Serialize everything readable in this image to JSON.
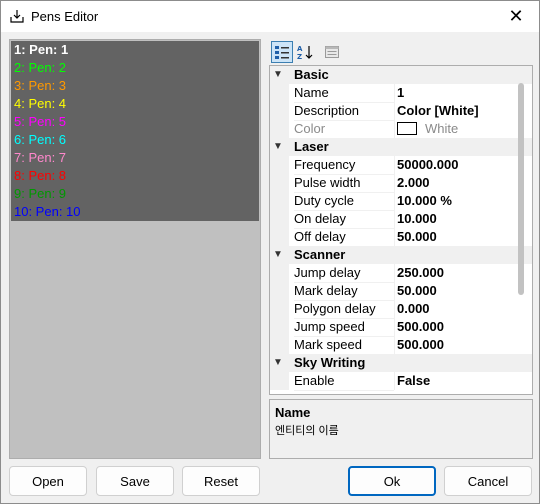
{
  "window": {
    "title": "Pens Editor",
    "close_glyph": "✕"
  },
  "pens": [
    {
      "label": "1: Pen: 1",
      "color": "#ffffff",
      "selected": true
    },
    {
      "label": "2: Pen: 2",
      "color": "#00ff00"
    },
    {
      "label": "3: Pen: 3",
      "color": "#ff9900"
    },
    {
      "label": "4: Pen: 4",
      "color": "#ffff00"
    },
    {
      "label": "5: Pen: 5",
      "color": "#ff00ff"
    },
    {
      "label": "6: Pen: 6",
      "color": "#00ffff"
    },
    {
      "label": "7: Pen: 7",
      "color": "#ff88cc"
    },
    {
      "label": "8: Pen: 8",
      "color": "#ff0000"
    },
    {
      "label": "9: Pen: 9",
      "color": "#009900"
    },
    {
      "label": "10: Pen: 10",
      "color": "#0000ff"
    }
  ],
  "toolbar": {
    "categorized_icon": "categorized-view-icon",
    "alphabetical_icon": "alphabetical-sort-icon",
    "property_pages_icon": "property-pages-icon"
  },
  "categories": {
    "basic": {
      "label": "Basic",
      "name": {
        "label": "Name",
        "value": "1"
      },
      "description": {
        "label": "Description",
        "value": "Color [White]"
      },
      "color": {
        "label": "Color",
        "value": "White"
      }
    },
    "laser": {
      "label": "Laser",
      "frequency": {
        "label": "Frequency",
        "value": "50000.000"
      },
      "pulse_width": {
        "label": "Pulse width",
        "value": "2.000"
      },
      "duty_cycle": {
        "label": "Duty cycle",
        "value": "10.000 %"
      },
      "on_delay": {
        "label": "On delay",
        "value": "10.000"
      },
      "off_delay": {
        "label": "Off delay",
        "value": "50.000"
      }
    },
    "scanner": {
      "label": "Scanner",
      "jump_delay": {
        "label": "Jump delay",
        "value": "250.000"
      },
      "mark_delay": {
        "label": "Mark delay",
        "value": "50.000"
      },
      "polygon_delay": {
        "label": "Polygon delay",
        "value": "0.000"
      },
      "jump_speed": {
        "label": "Jump speed",
        "value": "500.000"
      },
      "mark_speed": {
        "label": "Mark speed",
        "value": "500.000"
      }
    },
    "sky_writing": {
      "label": "Sky Writing",
      "enable": {
        "label": "Enable",
        "value": "False"
      }
    }
  },
  "description_panel": {
    "title": "Name",
    "text": "엔티티의 이름"
  },
  "buttons": {
    "open": "Open",
    "save": "Save",
    "reset": "Reset",
    "ok": "Ok",
    "cancel": "Cancel"
  },
  "colors": {
    "accent": "#0067c0",
    "list_bg": "#636363",
    "list_empty": "#c0c0c0"
  }
}
